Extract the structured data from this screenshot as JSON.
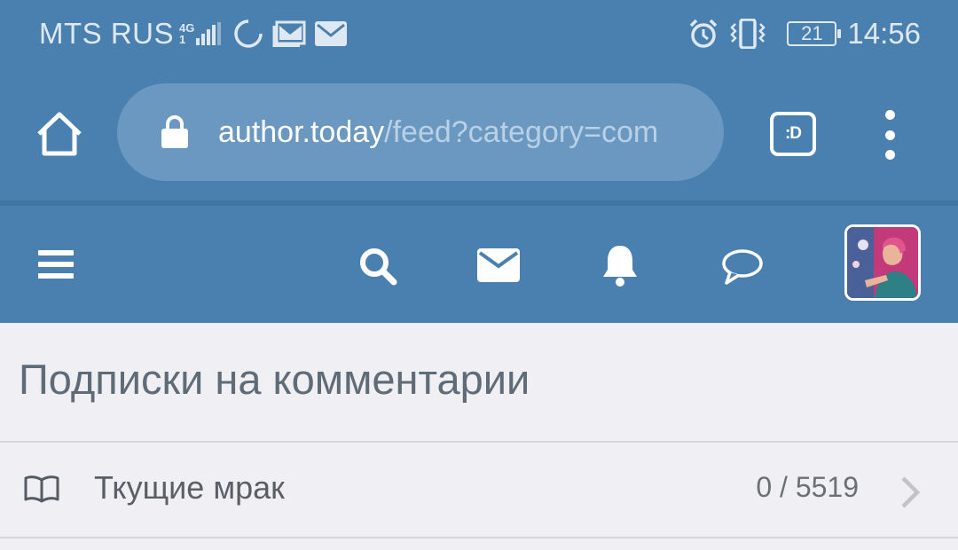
{
  "status_bar": {
    "carrier": "MTS RUS",
    "network_type_top": "4G",
    "network_type_bottom": "1",
    "clock": "14:56",
    "battery_level": "21",
    "icons": [
      "signal-icon",
      "sync-icon",
      "gallery-mail-icon",
      "mail-icon",
      "alarm-icon",
      "vibrate-icon",
      "battery-icon"
    ]
  },
  "browser": {
    "url_domain": "author.today",
    "url_path": "/feed?category=com",
    "extension_label": ":D",
    "icons": [
      "home-icon",
      "lock-icon",
      "menu-dots-icon"
    ]
  },
  "site_header": {
    "icons": [
      "hamburger-icon",
      "search-icon",
      "mail-icon",
      "bell-icon",
      "chat-icon",
      "avatar"
    ]
  },
  "content": {
    "page_title": "Подписки на комментарии",
    "items": [
      {
        "icon": "book-icon",
        "title": "Ткущие мрак",
        "count": "0 / 5519"
      }
    ]
  },
  "colors": {
    "header_blue": "#4a80b0",
    "url_pill": "#6b98c0",
    "background": "#f0eff4",
    "title_text": "#5f6b76"
  }
}
